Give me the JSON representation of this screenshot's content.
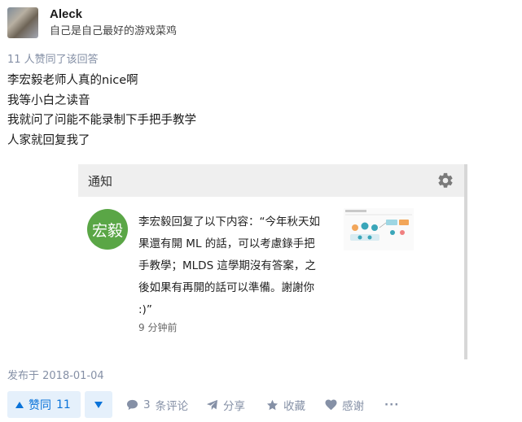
{
  "author": {
    "name": "Aleck",
    "bio": "自己是自己最好的游戏菜鸡"
  },
  "voters_text": "11 人赞同了该回答",
  "content": {
    "lines": [
      "李宏毅老师人真的nice啊",
      "我等小白之读音",
      "我就问了问能不能录制下手把手教学",
      "人家就回复我了"
    ]
  },
  "notification": {
    "title": "通知",
    "sender_avatar_text": "宏毅",
    "message_lines": [
      "李宏毅回复了以下内容：“今年秋天如",
      "果還有開 ML 的話，可以考慮錄手把",
      "手教學；MLDS 這學期沒有答案，之",
      "後如果有再開的話可以準備。謝謝你",
      ":)”"
    ],
    "time": "9 分钟前",
    "settings_icon": "gear-icon"
  },
  "published": "发布于 2018-01-04",
  "actions": {
    "vote_up_label": "赞同",
    "vote_up_count": "11",
    "comment_label": "条评论",
    "comment_count": "3",
    "share_label": "分享",
    "collect_label": "收藏",
    "thanks_label": "感谢",
    "more_label": "···"
  },
  "colors": {
    "accent": "#0a73d9",
    "meta_text": "#8590a6",
    "vote_bg": "#e5f0fb",
    "avatar_green": "#5aa646"
  }
}
